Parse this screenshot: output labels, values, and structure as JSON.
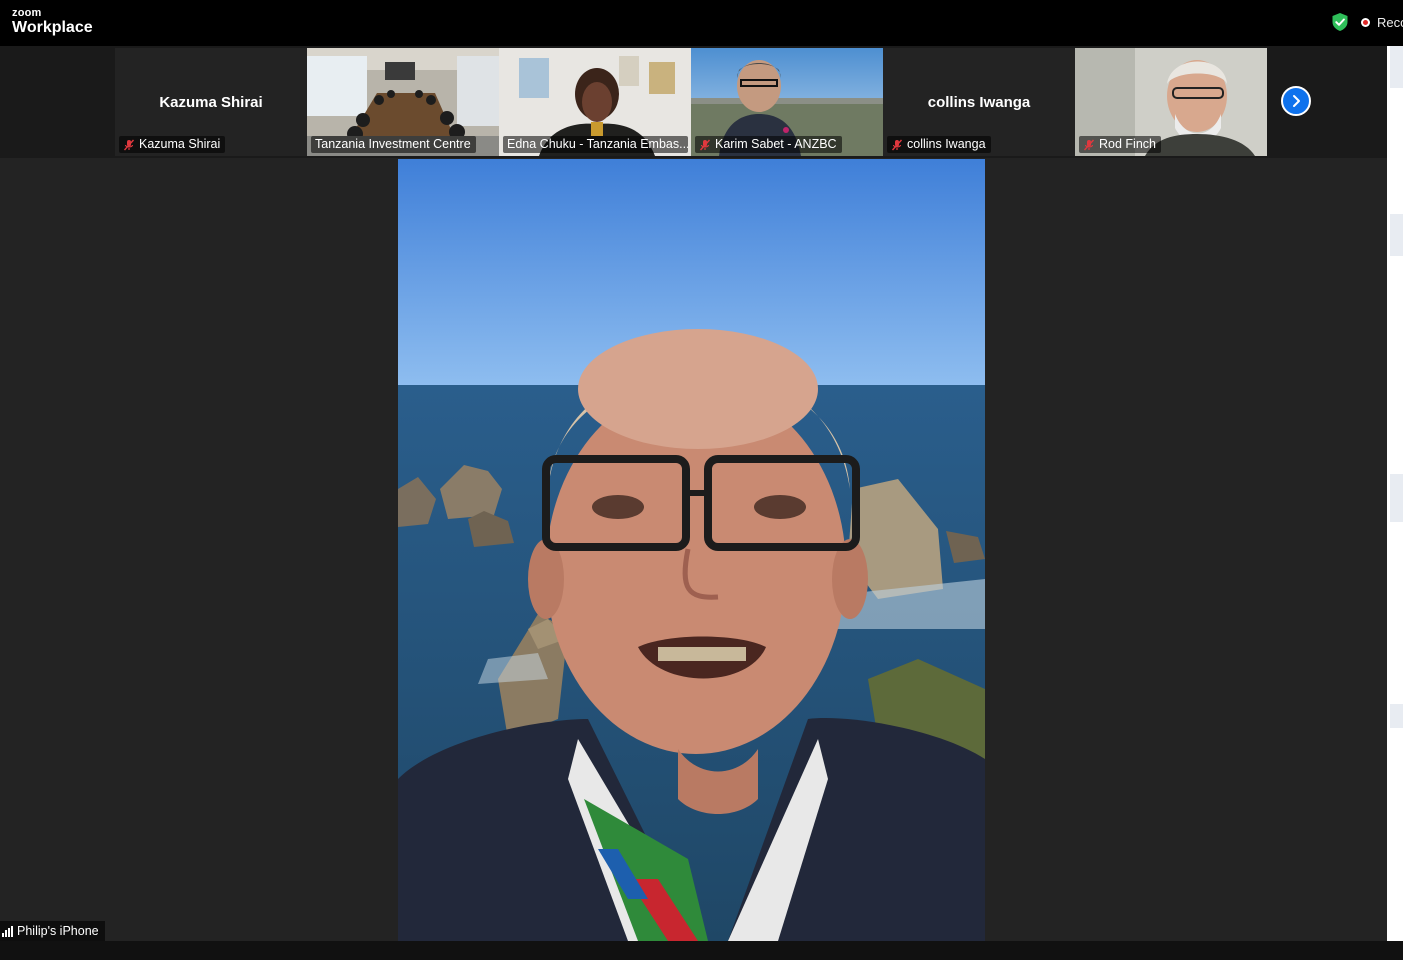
{
  "app": {
    "brand_small": "zoom",
    "brand_large": "Workplace"
  },
  "status": {
    "recording_text": "Reco",
    "secure_color": "#2fbf5a",
    "recording_color": "#e02828"
  },
  "filmstrip": {
    "participants": [
      {
        "name": "Kazuma Shirai",
        "label": "Kazuma Shirai",
        "video": false,
        "muted": true
      },
      {
        "name": "Tanzania Investment Centre",
        "label": "Tanzania Investment Centre",
        "video": true,
        "muted": false
      },
      {
        "name": "Edna Chuku - Tanzania Embassy",
        "label": "Edna Chuku - Tanzania Embas...",
        "video": true,
        "muted": false
      },
      {
        "name": "Karim Sabet - ANZBC",
        "label": "Karim Sabet - ANZBC",
        "video": true,
        "muted": true
      },
      {
        "name": "collins Iwanga",
        "label": "collins Iwanga",
        "video": false,
        "muted": true
      },
      {
        "name": "Rod Finch",
        "label": "Rod Finch",
        "video": true,
        "muted": true
      }
    ],
    "next_icon": "chevron-right-icon"
  },
  "active_speaker": {
    "label": "Philip's iPhone",
    "signal_icon": "signal-bars-icon"
  },
  "colors": {
    "accent": "#0e72ed",
    "muted_icon": "#e0383e",
    "background": "#1a1a1a"
  }
}
